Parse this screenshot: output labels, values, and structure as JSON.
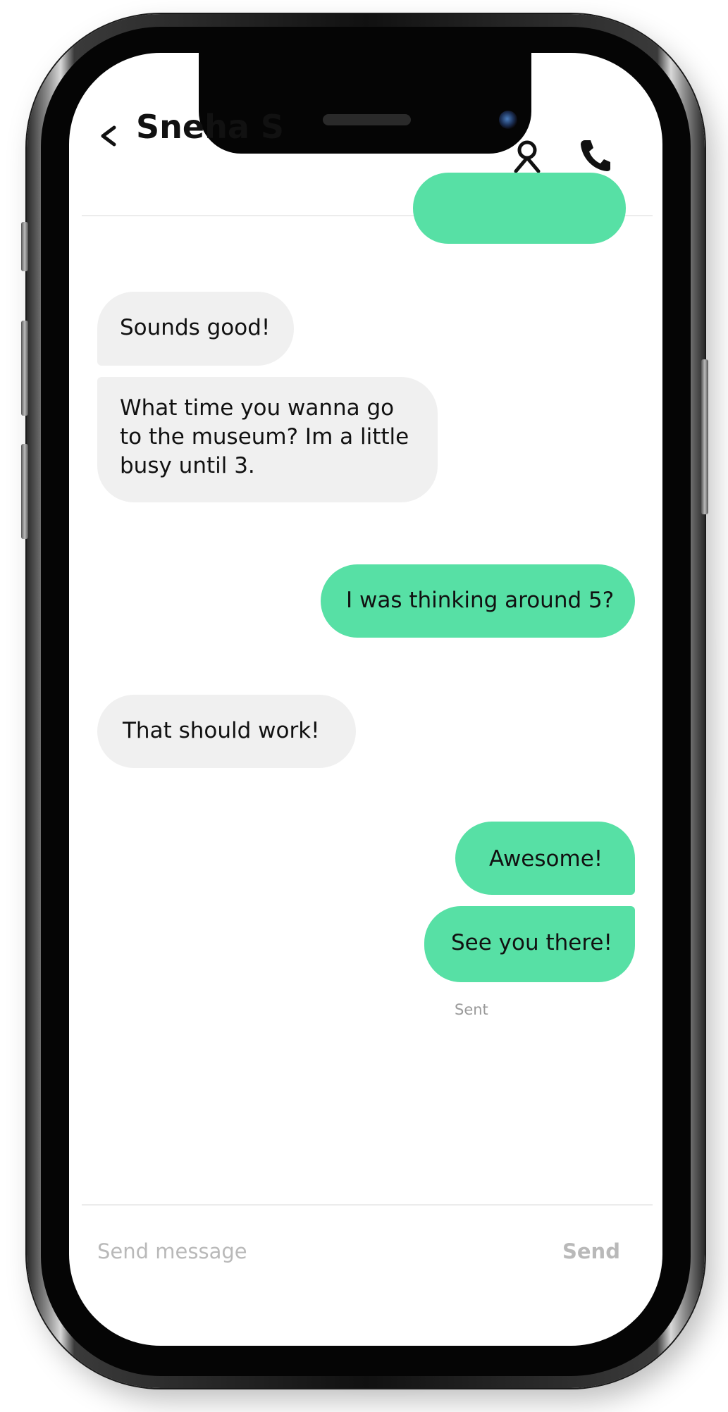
{
  "header": {
    "contact_name": "Sneha S",
    "back_icon": "chevron-left-icon",
    "profile_icon": "profile-icon",
    "call_icon": "phone-icon"
  },
  "messages": [
    {
      "direction": "sent",
      "text": ""
    },
    {
      "direction": "received",
      "text": "Sounds good!"
    },
    {
      "direction": "received",
      "text": "What time you wanna go to the museum? Im a little busy until 3."
    },
    {
      "direction": "sent",
      "text": "I was thinking around 5?"
    },
    {
      "direction": "received",
      "text": "That should work!"
    },
    {
      "direction": "sent",
      "text": "Awesome!"
    },
    {
      "direction": "sent",
      "text": "See you there!"
    }
  ],
  "status": {
    "sent_label": "Sent"
  },
  "composer": {
    "placeholder": "Send message",
    "send_label": "Send"
  },
  "colors": {
    "sent_bubble": "#57e0a5",
    "received_bubble": "#f0f0f0",
    "muted_text": "#b9b9b9"
  }
}
